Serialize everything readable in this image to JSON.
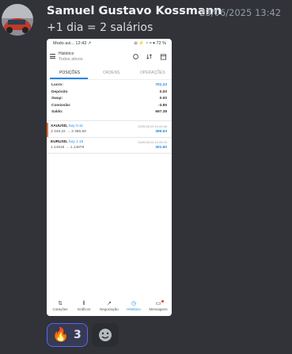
{
  "message": {
    "author": "Samuel Gustavo Kossmann",
    "timestamp": "23/06/2025 13:42",
    "text": "+1 dia = 2 salários"
  },
  "phone": {
    "status_left": "Modo avi... 12:43 ↗",
    "status_right": "⊝ ⚡ ◔ ≈ ▾ 72 %",
    "app_title": "Histórico",
    "app_subtitle": "Todos ativos",
    "tabs": [
      "POSIÇÕES",
      "ORDENS",
      "OPERAÇÕES"
    ],
    "summary": [
      {
        "label": "Lucro:",
        "value": "701.23"
      },
      {
        "label": "Depósito",
        "value": "0.00"
      },
      {
        "label": "Swap:",
        "value": "0.00"
      },
      {
        "label": "Comissão:",
        "value": "-3.85"
      },
      {
        "label": "Saldo:",
        "value": "697.38"
      }
    ],
    "positions": [
      {
        "symbol": "XAUUSD,",
        "side": "buy 0.11",
        "prices": "3 349.22 → 3 385.50",
        "date": "2025.06.23 10:41:46",
        "profit": "399.63"
      },
      {
        "symbol": "EURUSD,",
        "side": "buy 1.15",
        "prices": "1.14618 → 1.14878",
        "date": "2025.06.23 10:39:19",
        "profit": "301.60"
      }
    ],
    "nav": [
      "Cotações",
      "Gráficos",
      "Negociação",
      "Histórico",
      "Mensagens"
    ]
  },
  "reactions": [
    {
      "emoji": "🔥",
      "count": "3"
    }
  ],
  "colors": {
    "accent": "#5865f2",
    "blue": "#1e88e5",
    "orange": "#e8703a"
  }
}
